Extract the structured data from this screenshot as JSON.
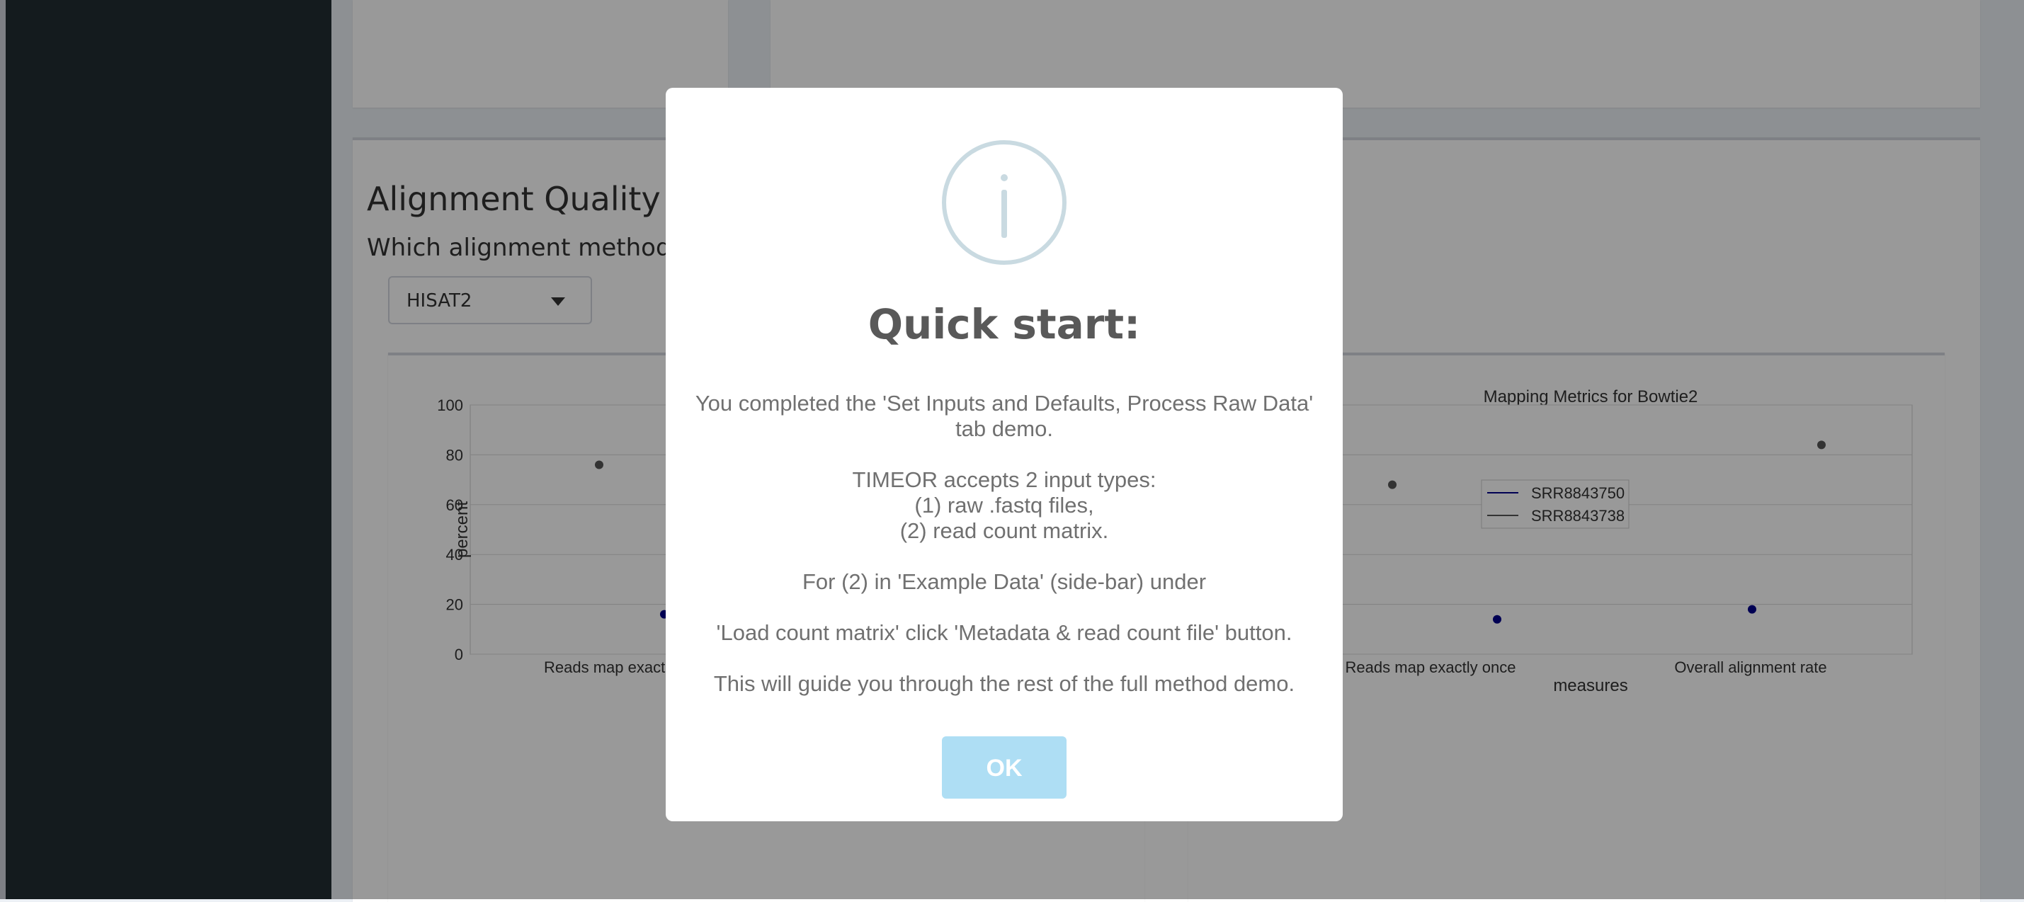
{
  "section": {
    "title": "Alignment Quality",
    "question": "Which alignment method?",
    "select_value": "HISAT2"
  },
  "charts": [
    {
      "title": "",
      "ylabel": "percent",
      "yticks": [
        "0",
        "20",
        "40",
        "60",
        "80",
        "100"
      ],
      "xtick_visible": "Reads map exact"
    },
    {
      "title": "Mapping Metrics for Bowtie2",
      "xlabel": "measures",
      "xticks": [
        "Reads map exactly once",
        "Overall alignment rate"
      ],
      "legend": [
        "SRR8843750",
        "SRR8843738"
      ]
    }
  ],
  "chart_data": [
    {
      "type": "scatter",
      "title": "",
      "xlabel": "",
      "ylabel": "percent",
      "ylim": [
        0,
        100
      ],
      "grid": true,
      "series": [
        {
          "name": "",
          "color": "#00008b",
          "points": [
            {
              "x": "Reads map exact",
              "y": 16
            }
          ]
        },
        {
          "name": "",
          "color": "#555555",
          "points": [
            {
              "x": "Reads map exact",
              "y": 76
            }
          ]
        }
      ]
    },
    {
      "type": "scatter",
      "title": "Mapping Metrics for Bowtie2",
      "xlabel": "measures",
      "ylabel": "",
      "ylim": [
        0,
        100
      ],
      "categories": [
        "Reads map exactly once",
        "Overall alignment rate"
      ],
      "legend_position": "top-center",
      "grid": true,
      "series": [
        {
          "name": "SRR8843750",
          "color": "#00008b",
          "values": [
            14,
            18
          ]
        },
        {
          "name": "SRR8843738",
          "color": "#555555",
          "values": [
            68,
            84
          ]
        }
      ]
    }
  ],
  "modal": {
    "title": "Quick start:",
    "lines": [
      "You completed the 'Set Inputs and Defaults, Process Raw Data'",
      "tab demo.",
      "",
      "TIMEOR accepts 2 input types:",
      "(1) raw .fastq files,",
      "(2) read count matrix.",
      "",
      "For (2) in 'Example Data' (side-bar) under",
      "",
      "'Load count matrix' click 'Metadata & read count file' button.",
      "",
      "This will guide you through the rest of the full method demo."
    ],
    "ok_label": "OK",
    "icon": "info-icon"
  },
  "colors": {
    "sidebar": "#222d32",
    "ok_button": "#aedef4",
    "series_blue": "#00008b",
    "series_gray": "#555555"
  }
}
